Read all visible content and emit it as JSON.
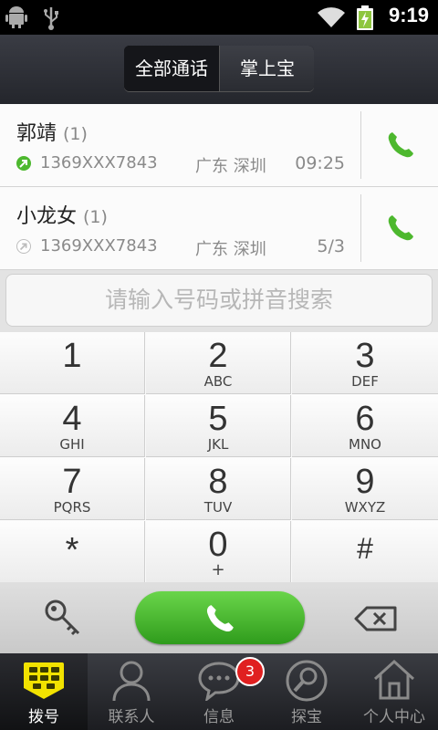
{
  "status_bar": {
    "time": "9:19"
  },
  "segments": [
    {
      "label": "全部通话"
    },
    {
      "label": "掌上宝"
    }
  ],
  "calls": [
    {
      "name": "郭靖",
      "count": "(1)",
      "number": "1369XXX7843",
      "location": "广东 深圳",
      "time": "09:25",
      "direction": "outgoing",
      "direction_color": "#4db82e"
    },
    {
      "name": "小龙女",
      "count": "(1)",
      "number": "1369XXX7843",
      "location": "广东 深圳",
      "time": "5/3",
      "direction": "outgoing-missed",
      "direction_color": "#bdbdbd"
    }
  ],
  "search": {
    "placeholder": "请输入号码或拼音搜索"
  },
  "keypad": [
    {
      "digit": "1",
      "letters": ""
    },
    {
      "digit": "2",
      "letters": "ABC"
    },
    {
      "digit": "3",
      "letters": "DEF"
    },
    {
      "digit": "4",
      "letters": "GHI"
    },
    {
      "digit": "5",
      "letters": "JKL"
    },
    {
      "digit": "6",
      "letters": "MNO"
    },
    {
      "digit": "7",
      "letters": "PQRS"
    },
    {
      "digit": "8",
      "letters": "TUV"
    },
    {
      "digit": "9",
      "letters": "WXYZ"
    },
    {
      "digit": "*",
      "letters": ""
    },
    {
      "digit": "0",
      "letters": "+"
    },
    {
      "digit": "#",
      "letters": ""
    }
  ],
  "tabs": [
    {
      "label": "拨号",
      "icon": "dialpad-icon"
    },
    {
      "label": "联系人",
      "icon": "contact-icon"
    },
    {
      "label": "信息",
      "icon": "message-icon"
    },
    {
      "label": "探宝",
      "icon": "explore-icon"
    },
    {
      "label": "个人中心",
      "icon": "home-icon"
    }
  ],
  "message_badge": "3",
  "colors": {
    "accent_green": "#3aa620",
    "active_tab_icon": "#f2e200"
  }
}
